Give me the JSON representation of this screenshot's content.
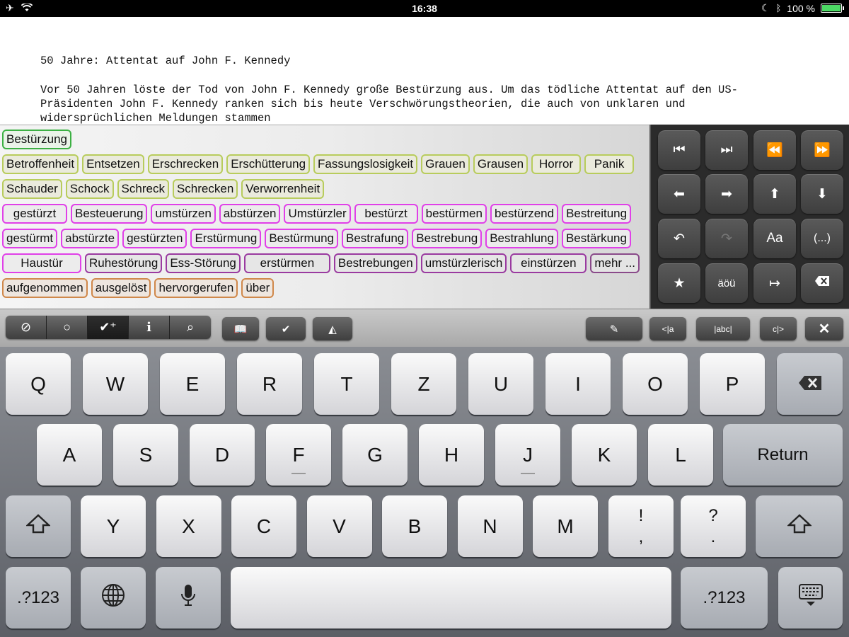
{
  "statusbar": {
    "time": "16:38",
    "battery": "100 %",
    "battery_level": 1.0
  },
  "document": {
    "headline": "50 Jahre: Attentat auf John F. Kennedy",
    "body": "Vor 50 Jahren löste der Tod von John F. Kennedy große Bestürzung aus. Um das tödliche Attentat auf den US-\nPräsidenten John F. Kennedy ranken sich bis heute Verschwörungstheorien, die auch von unklaren und\nwidersprüchlichen Meldungen stammen"
  },
  "suggestions": {
    "row1": [
      {
        "label": "Bestürzung",
        "kind": "green"
      }
    ],
    "row2": [
      {
        "label": "Betroffenheit",
        "kind": "lime"
      },
      {
        "label": "Entsetzen",
        "kind": "lime"
      },
      {
        "label": "Erschrecken",
        "kind": "lime"
      },
      {
        "label": "Erschütterung",
        "kind": "lime"
      },
      {
        "label": "Fassungslosigkeit",
        "kind": "lime"
      },
      {
        "label": "Grauen",
        "kind": "lime"
      },
      {
        "label": "Grausen",
        "kind": "lime"
      },
      {
        "label": "Horror",
        "kind": "lime"
      },
      {
        "label": "Panik",
        "kind": "lime"
      }
    ],
    "row3": [
      {
        "label": "Schauder",
        "kind": "lime"
      },
      {
        "label": "Schock",
        "kind": "lime"
      },
      {
        "label": "Schreck",
        "kind": "lime"
      },
      {
        "label": "Schrecken",
        "kind": "lime"
      },
      {
        "label": "Verworrenheit",
        "kind": "lime"
      }
    ],
    "row4": [
      {
        "label": "gestürzt",
        "kind": "pink"
      },
      {
        "label": "Besteuerung",
        "kind": "pink"
      },
      {
        "label": "umstürzen",
        "kind": "pink"
      },
      {
        "label": "abstürzen",
        "kind": "pink"
      },
      {
        "label": "Umstürzler",
        "kind": "pink"
      },
      {
        "label": "bestürzt",
        "kind": "pink"
      },
      {
        "label": "bestürmen",
        "kind": "pink"
      },
      {
        "label": "bestürzend",
        "kind": "pink"
      },
      {
        "label": "Bestreitung",
        "kind": "pink"
      }
    ],
    "row5": [
      {
        "label": "gestürmt",
        "kind": "pink"
      },
      {
        "label": "abstürzte",
        "kind": "pink"
      },
      {
        "label": "gestürzten",
        "kind": "pink"
      },
      {
        "label": "Erstürmung",
        "kind": "pink"
      },
      {
        "label": "Bestürmung",
        "kind": "pink"
      },
      {
        "label": "Bestrafung",
        "kind": "pink"
      },
      {
        "label": "Bestrebung",
        "kind": "pink"
      },
      {
        "label": "Bestrahlung",
        "kind": "pink"
      },
      {
        "label": "Bestärkung",
        "kind": "pink"
      }
    ],
    "row6": [
      {
        "label": "Haustür",
        "kind": "pink"
      },
      {
        "label": "Ruhestörung",
        "kind": "purple"
      },
      {
        "label": "Ess-Störung",
        "kind": "purple"
      },
      {
        "label": "erstürmen",
        "kind": "purple"
      },
      {
        "label": "Bestrebungen",
        "kind": "purple"
      },
      {
        "label": "umstürzlerisch",
        "kind": "purple"
      },
      {
        "label": "einstürzen",
        "kind": "purple"
      },
      {
        "label": "mehr ...",
        "kind": "more"
      }
    ],
    "row7": [
      {
        "label": "aufgenommen",
        "kind": "orange"
      },
      {
        "label": "ausgelöst",
        "kind": "orange"
      },
      {
        "label": "hervorgerufen",
        "kind": "orange"
      },
      {
        "label": "über",
        "kind": "orange"
      }
    ]
  },
  "pad": {
    "font_label": "Aa",
    "ellipsis_label": "(...)",
    "umlaut_label": "äöü"
  },
  "toolbar": {
    "markers": [
      "<|a",
      "|abc|",
      "c|>"
    ]
  },
  "keyboard": {
    "row1": [
      "Q",
      "W",
      "E",
      "R",
      "T",
      "Z",
      "U",
      "I",
      "O",
      "P"
    ],
    "row2": [
      "A",
      "S",
      "D",
      "F",
      "G",
      "H",
      "J",
      "K",
      "L"
    ],
    "return_label": "Return",
    "row3": [
      "Y",
      "X",
      "C",
      "V",
      "B",
      "N",
      "M"
    ],
    "punct1": [
      "!",
      ","
    ],
    "punct2": [
      "?",
      "."
    ],
    "numbers_label": ".?123"
  },
  "colors": {
    "green": "#3cb043",
    "lime": "#b8cc5c",
    "pink": "#e040e8",
    "purple": "#9a3aa0",
    "orange": "#d0884a"
  }
}
